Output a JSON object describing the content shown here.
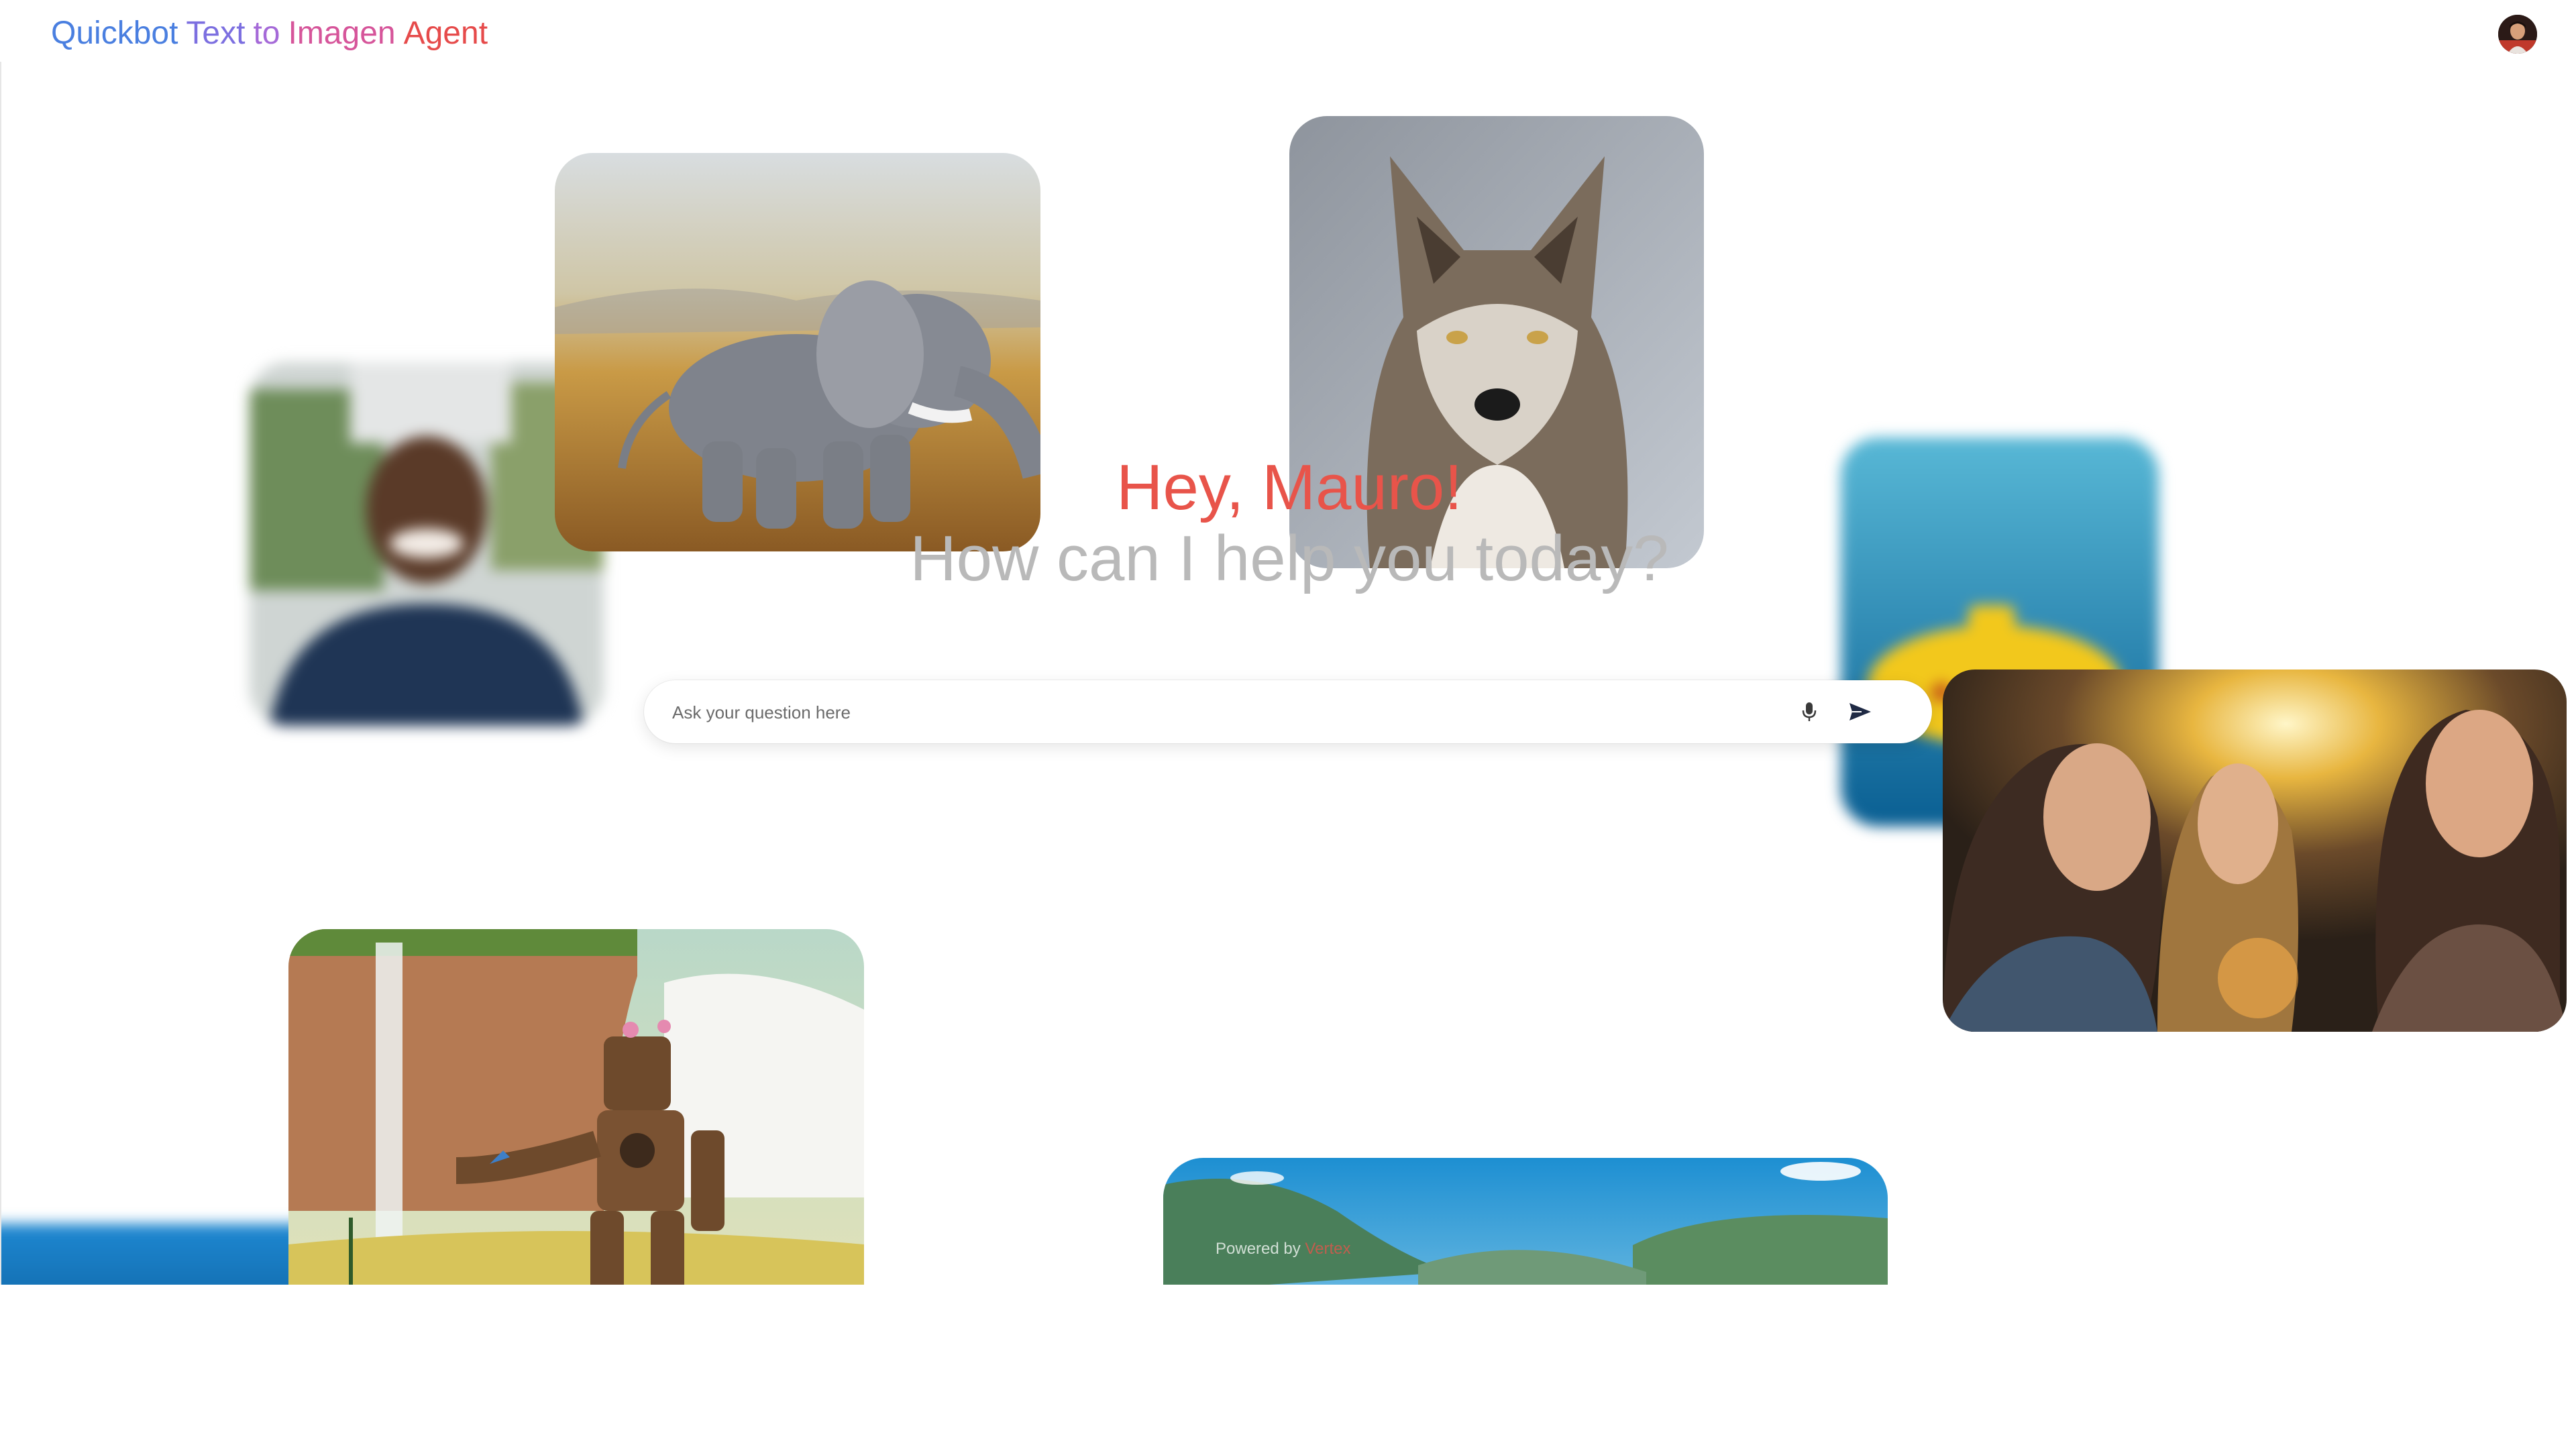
{
  "header": {
    "brand_words": [
      "Quickbot",
      "Text",
      "to",
      "Imagen",
      "Agent"
    ],
    "brand_colors": [
      "#4a7fe0",
      "#7c6fe0",
      "#a56ad8",
      "#d6559a",
      "#e64b4b"
    ]
  },
  "user": {
    "avatar_icon": "user-avatar"
  },
  "main": {
    "greeting": "Hey, Mauro!",
    "subtitle": "How can I help you today?"
  },
  "search": {
    "placeholder": "Ask your question here",
    "value": "",
    "mic_icon": "microphone-icon",
    "send_icon": "send-icon"
  },
  "footer": {
    "powered_prefix": "Powered by",
    "powered_brand": "Vertex"
  },
  "gallery": [
    {
      "name": "smiling-man-image",
      "blurred": true
    },
    {
      "name": "crochet-elephant-image",
      "blurred": false
    },
    {
      "name": "wolf-portrait-image",
      "blurred": false
    },
    {
      "name": "yellow-submarine-image",
      "blurred": true
    },
    {
      "name": "laughing-women-image",
      "blurred": false
    },
    {
      "name": "moss-robot-waterfall-image",
      "blurred": false
    },
    {
      "name": "mountain-lake-image",
      "blurred": false
    },
    {
      "name": "ocean-strip-image",
      "blurred": true
    }
  ],
  "colors": {
    "accent": "#e8544a",
    "subtitle": "#b9b9b9",
    "send": "#1f2a44"
  }
}
